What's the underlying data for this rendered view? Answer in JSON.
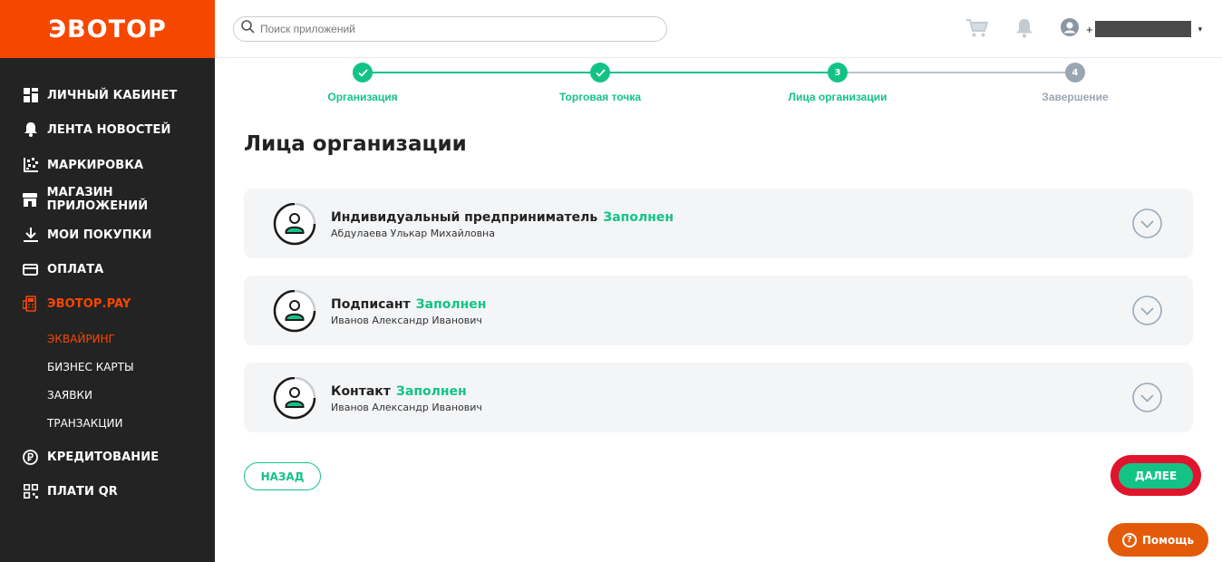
{
  "brand": {
    "logo": "ЭВОТОР",
    "accent": "#f64700",
    "success": "#13c386"
  },
  "sidebar": {
    "items": [
      {
        "label": "ЛИЧНЫЙ КАБИНЕТ",
        "icon": "dashboard-icon"
      },
      {
        "label": "ЛЕНТА НОВОСТЕЙ",
        "icon": "bell-icon"
      },
      {
        "label": "МАРКИРОВКА",
        "icon": "datamatrix-icon"
      },
      {
        "label": "МАГАЗИН ПРИЛОЖЕНИЙ",
        "icon": "store-icon"
      },
      {
        "label": "МОИ ПОКУПКИ",
        "icon": "download-icon"
      },
      {
        "label": "ОПЛАТА",
        "icon": "card-icon"
      },
      {
        "label": "ЭВОТОР.PAY",
        "icon": "terminal-icon",
        "active": true
      },
      {
        "label": "КРЕДИТОВАНИЕ",
        "icon": "ruble-icon"
      },
      {
        "label": "ПЛАТИ QR",
        "icon": "qr-icon"
      }
    ],
    "subitems": [
      {
        "label": "ЭКВАЙРИНГ",
        "active": true
      },
      {
        "label": "БИЗНЕС КАРТЫ"
      },
      {
        "label": "ЗАЯВКИ"
      },
      {
        "label": "ТРАНЗАКЦИИ"
      }
    ]
  },
  "header": {
    "search_placeholder": "Поиск приложений",
    "user_prefix": "+"
  },
  "stepper": {
    "steps": [
      {
        "label": "Организация",
        "state": "done"
      },
      {
        "label": "Торговая точка",
        "state": "done"
      },
      {
        "label": "Лица организации",
        "state": "current",
        "number": "3"
      },
      {
        "label": "Завершение",
        "state": "pending",
        "number": "4"
      }
    ]
  },
  "main": {
    "title": "Лица организации",
    "cards": [
      {
        "title": "Индивидуальный предприниматель",
        "status": "Заполнен",
        "name": "Абдулаева Улькар Михайловна"
      },
      {
        "title": "Подписант",
        "status": "Заполнен",
        "name": "Иванов Александр Иванович"
      },
      {
        "title": "Контакт",
        "status": "Заполнен",
        "name": "Иванов Александр Иванович"
      }
    ],
    "back_label": "НАЗАД",
    "next_label": "ДАЛЕЕ"
  },
  "help": {
    "label": "Помощь"
  }
}
